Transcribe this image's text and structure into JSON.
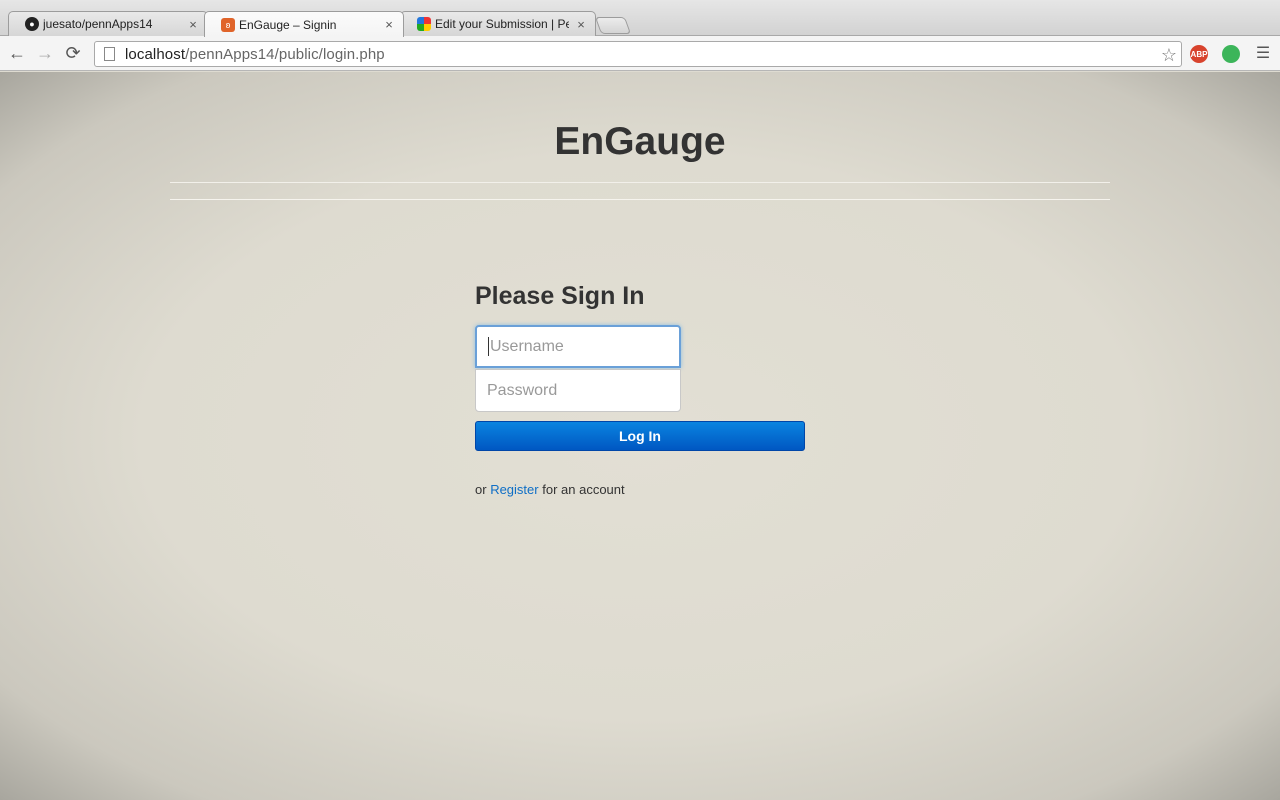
{
  "tabs": [
    {
      "title": "juesato/pennApps14",
      "close": "×",
      "favicon": "github-icon"
    },
    {
      "title": "EnGauge – Signin",
      "close": "×",
      "favicon": "xampp-icon"
    },
    {
      "title": "Edit your Submission | Pen",
      "close": "×",
      "favicon": "pinwheel-icon"
    }
  ],
  "toolbar": {
    "back": "←",
    "forward": "→",
    "reload": "⟳",
    "url_host": "localhost",
    "url_path": "/pennApps14/public/login.php",
    "star": "☆",
    "abp_label": "ABP",
    "menu": "☰"
  },
  "page": {
    "brand": "EnGauge",
    "heading": "Please Sign In",
    "username_placeholder": "Username",
    "password_placeholder": "Password",
    "login_label": "Log In",
    "register_prefix": "or",
    "register_link": "Register",
    "register_suffix": "for an account"
  },
  "colors": {
    "accent": "#0a6fd6",
    "background": "#dedbd1",
    "link": "#0f6fc6"
  }
}
